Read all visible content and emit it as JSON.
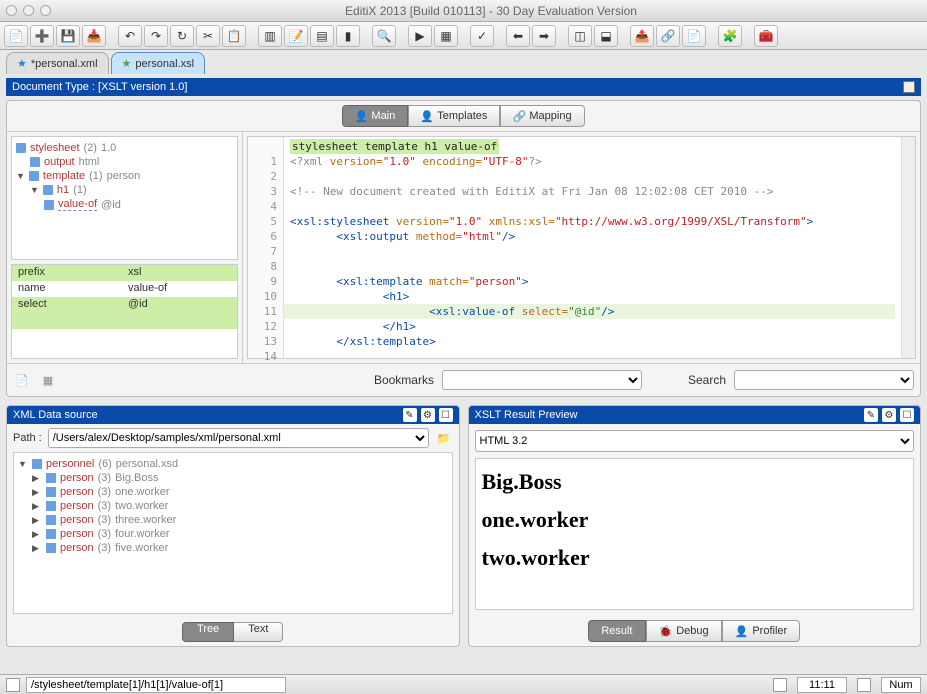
{
  "window": {
    "title": "EditiX 2013 [Build 010113] - 30 Day Evaluation Version"
  },
  "file_tabs": [
    {
      "label": "*personal.xml",
      "active": false
    },
    {
      "label": "personal.xsl",
      "active": true
    }
  ],
  "doc_type": {
    "label": "Document Type : [XSLT version 1.0]"
  },
  "main_tabs": {
    "main": "Main",
    "templates": "Templates",
    "mapping": "Mapping"
  },
  "outline": {
    "root": "stylesheet",
    "root_count": "(2)",
    "root_ver": "1.0",
    "output": "output",
    "output_val": "html",
    "template": "template",
    "template_count": "(1)",
    "template_val": "person",
    "h1": "h1",
    "h1_count": "(1)",
    "valueof": "value-of",
    "valueof_val": "@id"
  },
  "props": {
    "r1k": "prefix",
    "r1v": "xsl",
    "r2k": "name",
    "r2v": "value-of",
    "r3k": "select",
    "r3v": "@id"
  },
  "editor": {
    "crumbs": "stylesheet  template  h1  value-of",
    "lines": {
      "l1": {
        "t1": "<?xml ",
        "attr1": "version=",
        "val1": "\"1.0\"",
        "attr2": " encoding=",
        "val2": "\"UTF-8\"",
        "t2": "?>"
      },
      "l3": "<!-- New document created with EditiX at Fri Jan 08 12:02:08 CET 2010 -->",
      "l5": {
        "open": "<xsl:stylesheet ",
        "attr1": "version=",
        "val1": "\"1.0\"",
        "attr2": " xmlns:xsl=",
        "val2": "\"http://www.w3.org/1999/XSL/Transform\"",
        "close": ">"
      },
      "l6": {
        "open": "<xsl:output ",
        "attr": "method=",
        "val": "\"html\"",
        "close": "/>"
      },
      "l9": {
        "open": "<xsl:template ",
        "attr": "match=",
        "val": "\"person\"",
        "close": ">"
      },
      "l10": "<h1>",
      "l11": {
        "open": "<xsl:value-of ",
        "attr": "select=",
        "val": "\"@id\"",
        "close": "/>"
      },
      "l12": "</h1>",
      "l13": "</xsl:template>"
    }
  },
  "bookmarks": {
    "label": "Bookmarks"
  },
  "search": {
    "label": "Search"
  },
  "data_source": {
    "title": "XML Data source",
    "path_label": "Path :",
    "path_value": "/Users/alex/Desktop/samples/xml/personal.xml",
    "items": [
      {
        "tag": "personnel",
        "count": "(6)",
        "txt": "personal.xsd",
        "expand": "▼"
      },
      {
        "tag": "person",
        "count": "(3)",
        "txt": "Big.Boss",
        "expand": "▶"
      },
      {
        "tag": "person",
        "count": "(3)",
        "txt": "one.worker",
        "expand": "▶"
      },
      {
        "tag": "person",
        "count": "(3)",
        "txt": "two.worker",
        "expand": "▶"
      },
      {
        "tag": "person",
        "count": "(3)",
        "txt": "three.worker",
        "expand": "▶"
      },
      {
        "tag": "person",
        "count": "(3)",
        "txt": "four.worker",
        "expand": "▶"
      },
      {
        "tag": "person",
        "count": "(3)",
        "txt": "five.worker",
        "expand": "▶"
      }
    ],
    "tree_btn": "Tree",
    "text_btn": "Text"
  },
  "result": {
    "title": "XSLT Result Preview",
    "html_ver": "HTML 3.2",
    "items": [
      "Big.Boss",
      "one.worker",
      "two.worker"
    ],
    "result_btn": "Result",
    "debug_btn": "Debug",
    "profiler_btn": "Profiler"
  },
  "status": {
    "path": "/stylesheet/template[1]/h1[1]/value-of[1]",
    "pos": "11:11",
    "mode": "Num"
  }
}
